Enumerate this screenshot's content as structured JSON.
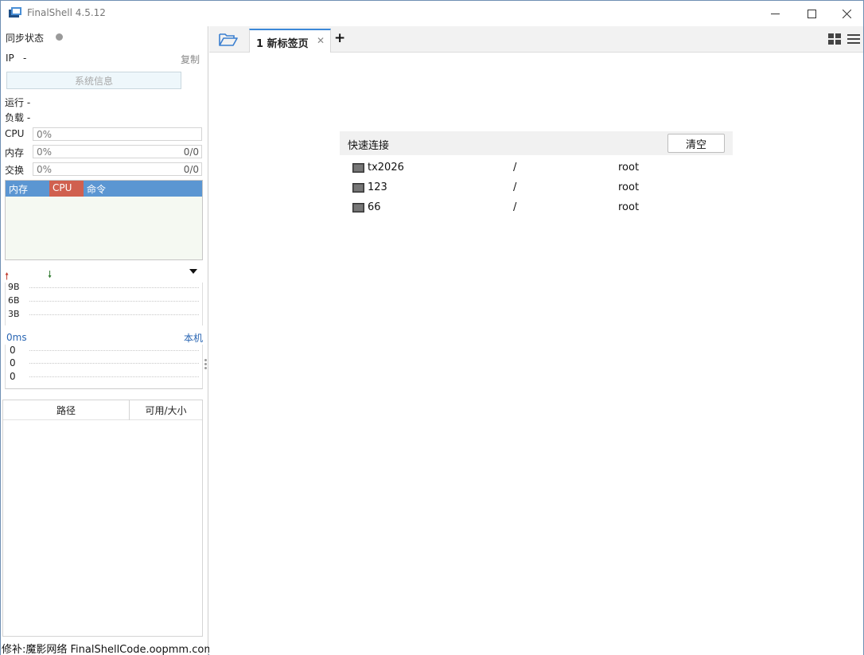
{
  "window": {
    "title": "FinalShell 4.5.12"
  },
  "sidebar": {
    "sync_label": "同步状态",
    "ip_label": "IP",
    "ip_value": "-",
    "copy_label": "复制",
    "sysinfo_label": "系统信息",
    "uptime_line": "运行 -",
    "load_line": "负载 -",
    "meters": [
      {
        "label": "CPU",
        "percent": "0%",
        "value": ""
      },
      {
        "label": "内存",
        "percent": "0%",
        "value": "0/0"
      },
      {
        "label": "交换",
        "percent": "0%",
        "value": "0/0"
      }
    ],
    "process_columns": [
      "内存",
      "CPU",
      "命令"
    ],
    "network": {
      "ticks": [
        "9B",
        "6B",
        "3B"
      ]
    },
    "latency": {
      "ms_label": "0ms",
      "host_label": "本机",
      "ticks": [
        "0",
        "0",
        "0"
      ]
    },
    "disk_columns": {
      "path": "路径",
      "size": "可用/大小"
    },
    "footer": "修补:魔影网络 FinalShellCode.oopmm.com"
  },
  "tabs": [
    {
      "label": "1 新标签页",
      "active": true
    }
  ],
  "quick_connect": {
    "title": "快速连接",
    "clear_label": "清空",
    "connections": [
      {
        "name": "tx2026",
        "path": "/",
        "user": "root"
      },
      {
        "name": "123",
        "path": "/",
        "user": "root"
      },
      {
        "name": "66",
        "path": "/",
        "user": "root"
      }
    ]
  },
  "colors": {
    "accent": "#3b88d8",
    "process_header": "#5b96d2",
    "cpu_header": "#d0604f"
  }
}
